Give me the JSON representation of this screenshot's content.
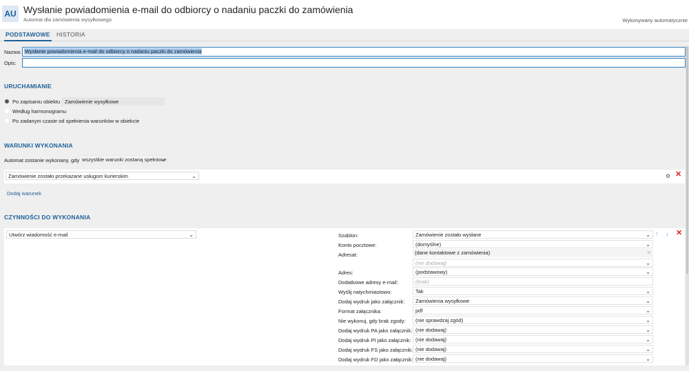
{
  "header": {
    "badge": "AU",
    "title": "Wysłanie powiadomienia e-mail do odbiorcy o nadaniu paczki do zamówienia",
    "subtitle": "Automat dla zamówienia wysyłkowego",
    "mode": "Wykonywany automatycznie"
  },
  "tabs": [
    "PODSTAWOWE",
    "HISTORIA"
  ],
  "form": {
    "name_label": "Nazwa:",
    "name_value": "Wysłanie powiadomienia e-mail do odbiorcy o nadaniu paczki do zamówienia",
    "desc_label": "Opis:",
    "desc_value": ""
  },
  "uruchamianie": {
    "title": "URUCHAMIANIE",
    "option1": "Po zapisaniu obiektu",
    "option1_object": "Zamówienie wysyłkowe",
    "option2": "Według harmonogramu",
    "option3": "Po zadanym czasie od spełnienia warunków w obiekcie"
  },
  "warunki": {
    "title": "WARUNKI WYKONANIA",
    "prefix": "Automat zostanie wykonany, gdy",
    "mode": "wszystkie warunki zostaną spełnione",
    "condition": "Zamówienie zostało przekazane usługom kurierskim",
    "add_link": "Dodaj warunek"
  },
  "czynnosci": {
    "title": "CZYNNOŚCI DO WYKONANIA",
    "action": "Utwórz wiadomość e-mail",
    "fields": {
      "szablon_label": "Szablon:",
      "szablon_value": "Zamówienie zostało wysłane",
      "konto_label": "Konto pocztowe:",
      "konto_value": "(domyślne)",
      "adresat_label": "Adresat:",
      "adresat_value": "(dane kontaktowe z zamówienia)",
      "adresat_add": "(nie dodawaj)",
      "adres_label": "Adres:",
      "adres_value": "(podstawowy)",
      "dodatkowe_label": "Dodatkowe adresy e-mail:",
      "dodatkowe_value": "(brak)",
      "wyslij_label": "Wyślij natychmiastowo:",
      "wyslij_value": "Tak",
      "wydruk_label": "Dodaj wydruk jako załącznik:",
      "wydruk_value": "Zamówienia wysyłkowe",
      "format_label": "Format załącznika:",
      "format_value": "pdf",
      "zgoda_label": "Nie wykonuj, gdy brak zgody:",
      "zgoda_value": "(nie sprawdzaj zgód)",
      "pa_label": "Dodaj wydruk PA jako załącznik:",
      "pa_value": "(nie dodawaj)",
      "pi_label": "Dodaj wydruk PI jako załącznik:",
      "pi_value": "(nie dodawaj)",
      "fs_label": "Dodaj wydruk FS jako załącznik:",
      "fs_value": "(nie dodawaj)",
      "fd_label": "Dodaj wydruk FD jako załącznik:",
      "fd_value": "(nie dodawaj)"
    }
  },
  "colors": {
    "accent": "#1d5f99",
    "delete": "#dd2222"
  }
}
